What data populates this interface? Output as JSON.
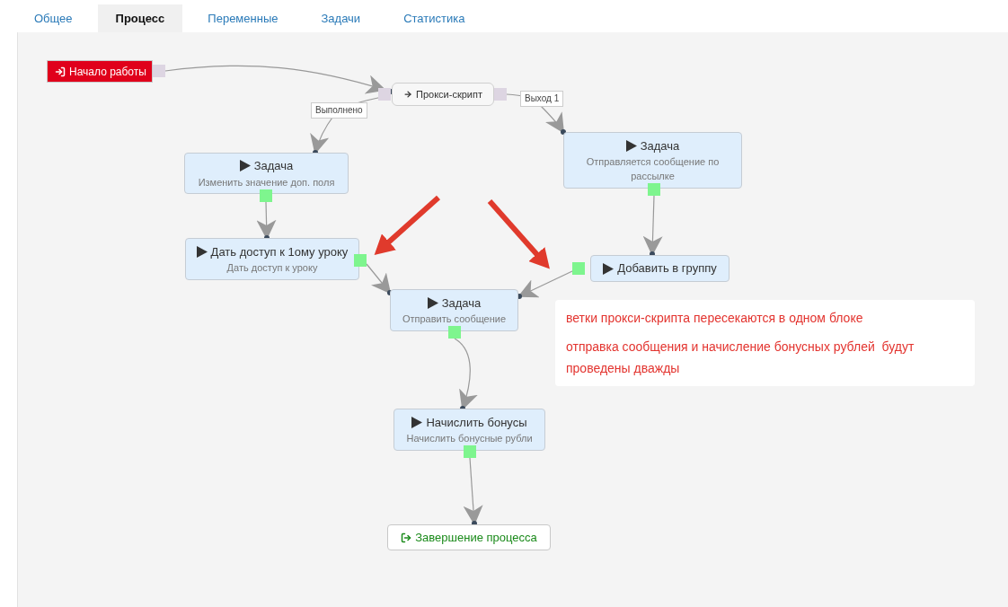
{
  "tabs": [
    {
      "label": "Общее",
      "selected": false
    },
    {
      "label": "Процесс",
      "selected": true
    },
    {
      "label": "Переменные",
      "selected": false
    },
    {
      "label": "Задачи",
      "selected": false
    },
    {
      "label": "Статистика",
      "selected": false
    }
  ],
  "nodes": [
    {
      "kind": "start",
      "title": "Начало работы"
    },
    {
      "kind": "proxy",
      "title": "Прокси-скрипт"
    },
    {
      "kind": "task",
      "title": "Задача",
      "subtitle": "Изменить значение доп. поля"
    },
    {
      "kind": "task",
      "title": "Дать доступ к 1ому уроку",
      "subtitle": "Дать доступ к уроку"
    },
    {
      "kind": "task",
      "title": "Задача",
      "subtitle": "Отправляется сообщение по рассылке"
    },
    {
      "kind": "task",
      "title": "Добавить в группу"
    },
    {
      "kind": "task",
      "title": "Задача",
      "subtitle": "Отправить сообщение"
    },
    {
      "kind": "task",
      "title": "Начислить бонусы",
      "subtitle": "Начислить бонусные рубли"
    },
    {
      "kind": "finish",
      "title": "Завершение процесса"
    }
  ],
  "edge_labels": [
    "Выполнено",
    "Выход 1"
  ],
  "note": {
    "lines": [
      "ветки прокси-скрипта пересекаются в одном блоке",
      "отправка сообщения и начисление бонусных рублей  будут проведены дважды"
    ]
  }
}
